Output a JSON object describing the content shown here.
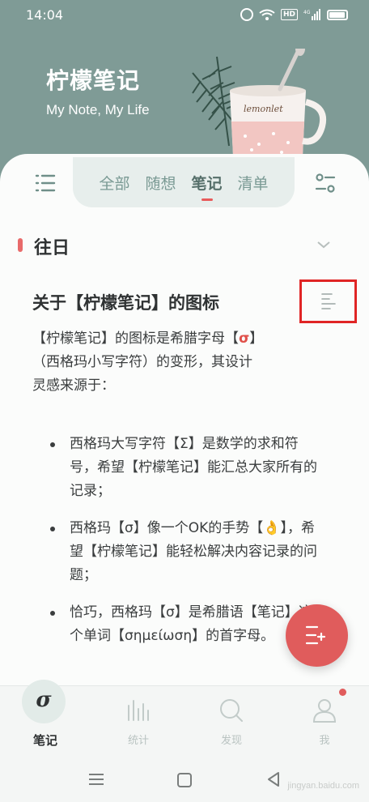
{
  "status_bar": {
    "time": "14:04",
    "hd": "HD",
    "network": "4G"
  },
  "header": {
    "title": "柠檬笔记",
    "subtitle": "My Note, My Life",
    "mug_text": "lemonlet"
  },
  "tabs": [
    {
      "label": "全部",
      "active": false
    },
    {
      "label": "随想",
      "active": false
    },
    {
      "label": "笔记",
      "active": true
    },
    {
      "label": "清单",
      "active": false
    }
  ],
  "section": {
    "title": "往日"
  },
  "note": {
    "title": "关于【柠檬笔记】的图标",
    "intro_a": "【柠檬笔记】的图标是希腊字母【",
    "intro_sigma": "σ",
    "intro_b": "】",
    "intro_line2": "（西格玛小写字符）的变形，其设计",
    "intro_line3": "灵感来源于：",
    "bullets": [
      "西格玛大写字符【Σ】是数学的求和符号，希望【柠檬笔记】能汇总大家所有的记录；",
      "西格玛【σ】像一个OK的手势【👌】，希望【柠檬笔记】能轻松解决内容记录的问题；",
      "恰巧，西格玛【σ】是希腊语【笔记】这个单词【σημείωση】的首字母。"
    ]
  },
  "bottom_nav": [
    {
      "label": "笔记",
      "icon": "sigma-icon",
      "active": true
    },
    {
      "label": "统计",
      "icon": "stats-icon",
      "active": false
    },
    {
      "label": "发现",
      "icon": "search-icon",
      "active": false
    },
    {
      "label": "我",
      "icon": "user-icon",
      "active": false
    }
  ],
  "sigma_glyph": "σ",
  "watermark": "jingyan.baidu.com",
  "colors": {
    "header": "#7f9b96",
    "accent": "#e05c5c",
    "tab_bg": "#e7eeec"
  }
}
